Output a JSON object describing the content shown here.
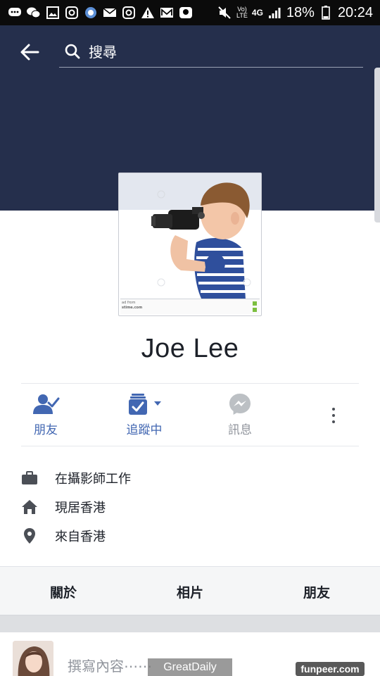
{
  "status_bar": {
    "battery_percent": "18%",
    "time": "20:24",
    "volte_top": "Vo)",
    "volte_bottom": "LTE",
    "network": "4G",
    "icons": [
      "chat-icon",
      "wechat-icon",
      "gallery-icon",
      "instagram-icon",
      "browser-icon",
      "mail-icon",
      "instagram-icon",
      "warning-icon",
      "email-icon",
      "baby-icon",
      "mute-icon",
      "signal-icon",
      "battery-icon"
    ]
  },
  "header": {
    "search_placeholder": "搜尋"
  },
  "profile": {
    "name": "Joe Lee",
    "photo_watermark_top": "ad from",
    "photo_watermark_site": "stime.com"
  },
  "actions": {
    "friends_label": "朋友",
    "following_label": "追蹤中",
    "message_label": "訊息"
  },
  "info": {
    "work": "在攝影師工作",
    "lives_in": "現居香港",
    "from": "來自香港"
  },
  "tabs": {
    "about": "關於",
    "photos": "相片",
    "friends": "朋友"
  },
  "composer": {
    "placeholder": "撰寫內容⋯⋯"
  },
  "watermarks": {
    "greatdaily": "GreatDaily",
    "funpeer": "funpeer.com"
  },
  "colors": {
    "cover": "#252f4c",
    "accent": "#4267b2",
    "status_bar": "#0b0b0b"
  }
}
